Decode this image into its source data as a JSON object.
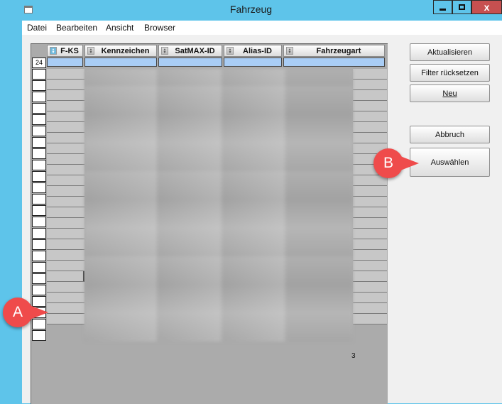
{
  "window": {
    "title": "Fahrzeug",
    "close_glyph": "x"
  },
  "menu": [
    "Datei",
    "Bearbeiten",
    "Ansicht",
    "Browser"
  ],
  "grid": {
    "columns": [
      "F-KS",
      "Kennzeichen",
      "SatMAX-ID",
      "Alias-ID",
      "Fahrzeugart"
    ],
    "record_count": "24",
    "status_value": "3"
  },
  "buttons": {
    "refresh": "Aktualisieren",
    "reset_filter": "Filter rücksetzen",
    "new": "Neu",
    "cancel": "Abbruch",
    "select": "Auswählen"
  },
  "callouts": {
    "a": "A",
    "b": "B"
  }
}
